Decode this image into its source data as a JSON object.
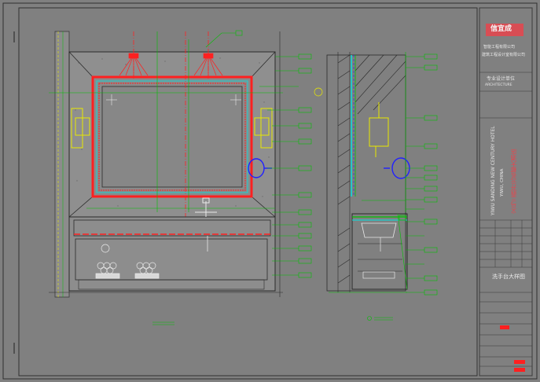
{
  "title_block": {
    "logo_text": "信宜成",
    "company_lines": [
      "智能工程有限公司",
      "建筑工程设计室有限公司"
    ],
    "section_label": "专业设计单位",
    "section_sublabel": "ARCHITECTURE",
    "project_en_line1": "YIWU SANDING NEW CENTURY HOTEL",
    "project_en_line2": "YIWU, CHINA",
    "project_cn": "义乌三鼎开元名都大酒店",
    "drawing_title": "洗手台大样图"
  },
  "colors": {
    "background": "#808080",
    "line_dark": "#222222",
    "line_green": "#00c000",
    "line_red": "#ff2020",
    "line_cyan": "#00e5e5",
    "line_yellow": "#e8e800",
    "line_blue": "#2020ff",
    "title_red": "#e8444c"
  }
}
